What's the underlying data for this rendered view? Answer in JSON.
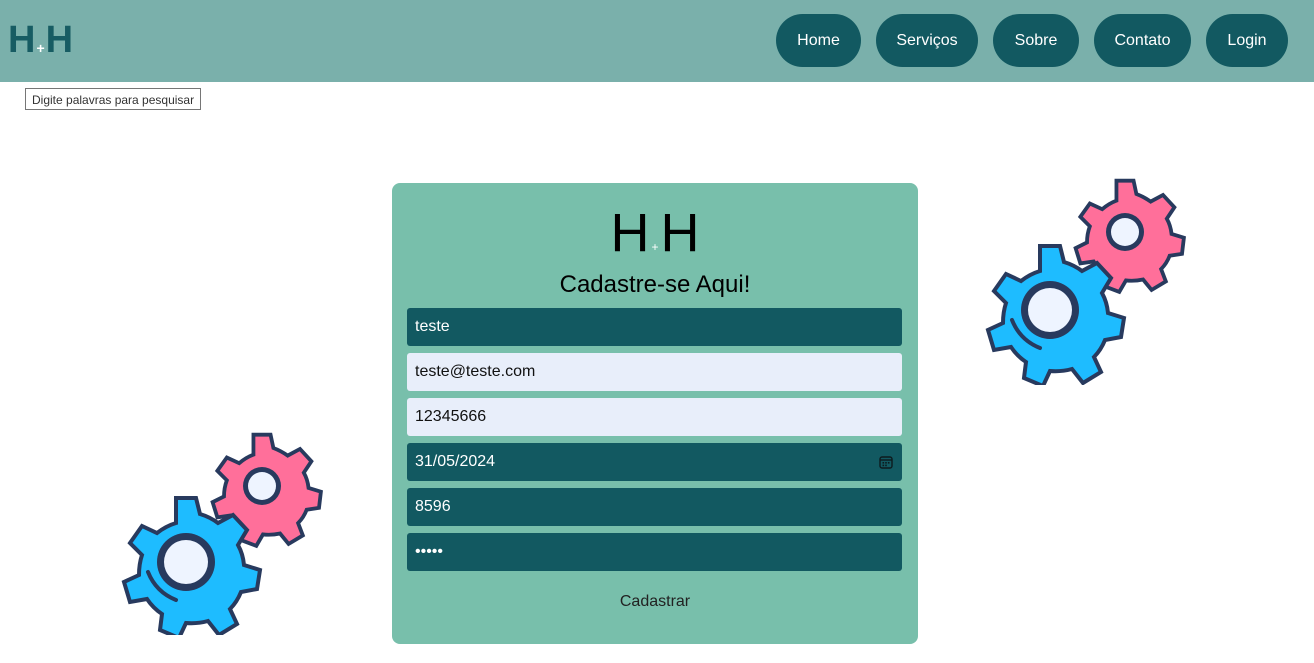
{
  "header": {
    "logo": {
      "left": "H",
      "plus": "+",
      "right": "H"
    },
    "nav": [
      {
        "label": "Home"
      },
      {
        "label": "Serviços"
      },
      {
        "label": "Sobre"
      },
      {
        "label": "Contato"
      },
      {
        "label": "Login"
      }
    ]
  },
  "tooltip": "Digite palavras para pesquisar",
  "form": {
    "logo": {
      "left": "H",
      "plus": "+",
      "right": "H"
    },
    "title": "Cadastre-se Aqui!",
    "fields": {
      "name": "teste",
      "email": "teste@teste.com",
      "phone": "12345666",
      "date": "31/05/2024",
      "number": "8596",
      "password": "•••••"
    },
    "submit_label": "Cadastrar"
  },
  "colors": {
    "navbar": "#7ab0ab",
    "nav_button": "#125961",
    "card": "#78bfab",
    "field_dark": "#125961",
    "field_light": "#e8eefa",
    "gear_pink": "#ff6f9a",
    "gear_blue": "#1ebcff"
  },
  "decorations": [
    "gears-illustration-right",
    "gears-illustration-left"
  ]
}
